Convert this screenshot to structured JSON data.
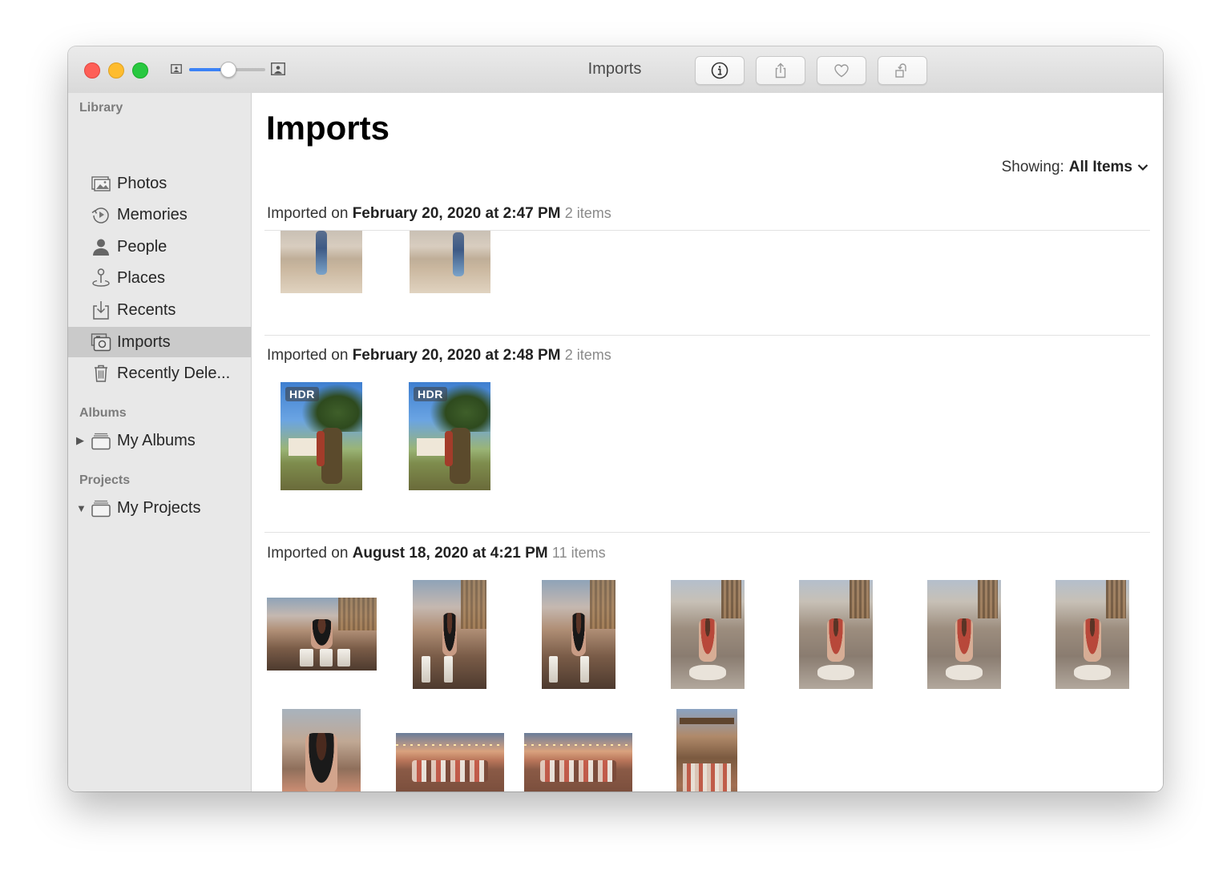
{
  "window": {
    "title": "Imports",
    "zoom_slider_value": 0.5
  },
  "toolbar": {
    "buttons": [
      {
        "name": "info",
        "icon": "info-icon"
      },
      {
        "name": "share",
        "icon": "share-icon"
      },
      {
        "name": "favorite",
        "icon": "heart-icon"
      },
      {
        "name": "rotate",
        "icon": "rotate-icon"
      }
    ]
  },
  "sidebar": {
    "sections": [
      {
        "label": "Library"
      },
      {
        "label": "Albums"
      },
      {
        "label": "Projects"
      }
    ],
    "library_items": [
      {
        "label": "Photos",
        "icon": "photos-icon",
        "selected": false
      },
      {
        "label": "Memories",
        "icon": "memories-icon",
        "selected": false
      },
      {
        "label": "People",
        "icon": "person-icon",
        "selected": false
      },
      {
        "label": "Places",
        "icon": "pin-icon",
        "selected": false
      },
      {
        "label": "Recents",
        "icon": "import-tray-icon",
        "selected": false
      },
      {
        "label": "Imports",
        "icon": "camera-icon",
        "selected": true
      },
      {
        "label": "Recently Dele...",
        "icon": "trash-icon",
        "selected": false
      }
    ],
    "albums_items": [
      {
        "label": "My Albums",
        "icon": "folder-icon",
        "disclosure": "collapsed"
      }
    ],
    "projects_items": [
      {
        "label": "My Projects",
        "icon": "folder-icon",
        "disclosure": "expanded"
      }
    ]
  },
  "main": {
    "title": "Imports",
    "filter": {
      "label": "Showing:",
      "value": "All Items"
    },
    "groups": [
      {
        "prefix": "Imported on",
        "date": "February 20, 2020 at 2:47 PM",
        "count": "2 items",
        "photos": [
          {
            "style": "stone",
            "badge": ""
          },
          {
            "style": "stone",
            "badge": ""
          }
        ]
      },
      {
        "prefix": "Imported on",
        "date": "February 20, 2020 at 2:48 PM",
        "count": "2 items",
        "photos": [
          {
            "style": "palm",
            "badge": "HDR"
          },
          {
            "style": "palm",
            "badge": "HDR"
          }
        ]
      },
      {
        "prefix": "Imported on",
        "date": "August 18, 2020 at 4:21 PM",
        "count": "11 items",
        "photos": [
          {
            "style": "sunset",
            "badge": ""
          },
          {
            "style": "sunset",
            "badge": ""
          },
          {
            "style": "sunset",
            "badge": ""
          },
          {
            "style": "deck",
            "badge": ""
          },
          {
            "style": "deck",
            "badge": ""
          },
          {
            "style": "deck",
            "badge": ""
          },
          {
            "style": "deck",
            "badge": ""
          },
          {
            "style": "portrait",
            "badge": ""
          },
          {
            "style": "group",
            "badge": ""
          },
          {
            "style": "group",
            "badge": ""
          },
          {
            "style": "pergola",
            "badge": ""
          }
        ]
      }
    ]
  }
}
